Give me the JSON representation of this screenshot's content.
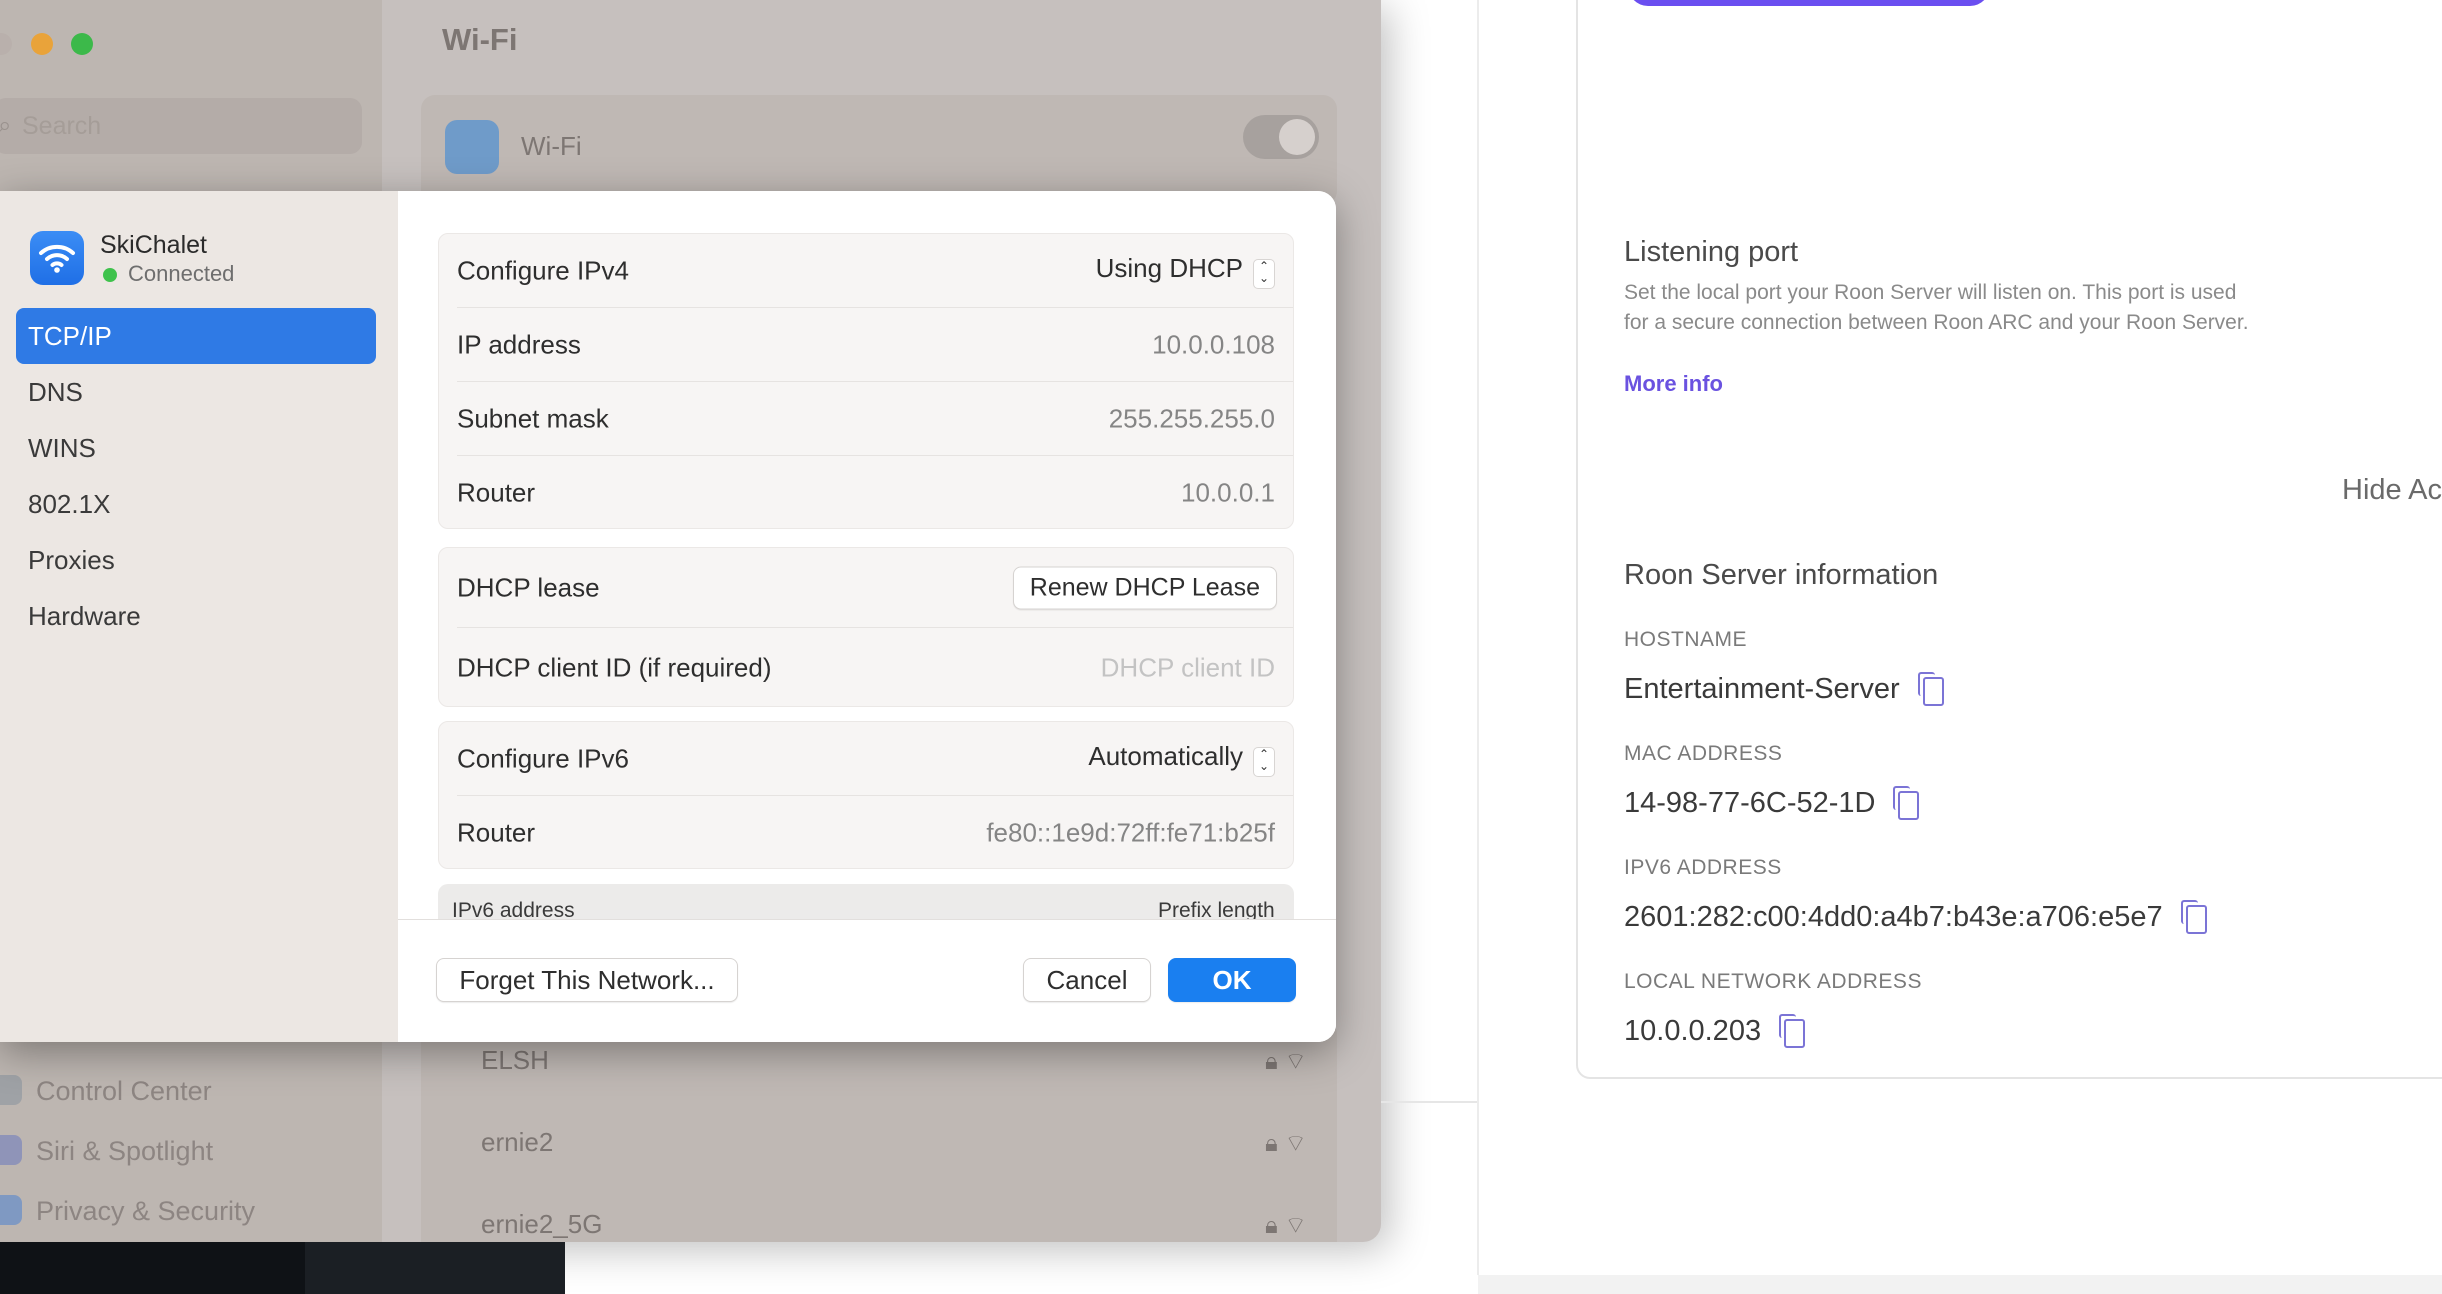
{
  "settings": {
    "title": "Wi-Fi",
    "search_placeholder": "Search",
    "wifi_label": "Wi-Fi",
    "sidebar_items": [
      "Control Center",
      "Siri & Spotlight",
      "Privacy & Security"
    ],
    "networks": [
      "ELSH",
      "ernie2",
      "ernie2_5G"
    ]
  },
  "dialog": {
    "network_name": "SkiChalet",
    "network_status": "Connected",
    "nav": [
      "TCP/IP",
      "DNS",
      "WINS",
      "802.1X",
      "Proxies",
      "Hardware"
    ],
    "active_nav": "TCP/IP",
    "ipv4": {
      "configure_label": "Configure IPv4",
      "configure_value": "Using DHCP",
      "ip_label": "IP address",
      "ip_value": "10.0.0.108",
      "subnet_label": "Subnet mask",
      "subnet_value": "255.255.255.0",
      "router_label": "Router",
      "router_value": "10.0.0.1"
    },
    "dhcp": {
      "lease_label": "DHCP lease",
      "renew_button": "Renew DHCP Lease",
      "client_id_label": "DHCP client ID (if required)",
      "client_id_placeholder": "DHCP client ID"
    },
    "ipv6": {
      "configure_label": "Configure IPv6",
      "configure_value": "Automatically",
      "router_label": "Router",
      "router_value": "fe80::1e9d:72ff:fe71:b25f",
      "table_col_address": "IPv6 address",
      "table_col_prefix": "Prefix length"
    },
    "buttons": {
      "forget": "Forget This Network...",
      "cancel": "Cancel",
      "ok": "OK"
    }
  },
  "roon": {
    "listening_port_title": "Listening port",
    "listening_port_desc": "Set the local port your Roon Server will listen on. This port is used for a secure connection between Roon ARC and your Roon Server.",
    "more_info": "More info",
    "hide_advanced": "Hide Ac",
    "server_info_title": "Roon Server information",
    "hostname_label": "HOSTNAME",
    "hostname_value": "Entertainment-Server",
    "mac_label": "MAC ADDRESS",
    "mac_value": "14-98-77-6C-52-1D",
    "ipv6_label": "IPV6 ADDRESS",
    "ipv6_value": "2601:282:c00:4dd0:a4b7:b43e:a706:e5e7",
    "local_label": "LOCAL NETWORK ADDRESS",
    "local_value": "10.0.0.203",
    "accent_color": "#6a52e0"
  }
}
